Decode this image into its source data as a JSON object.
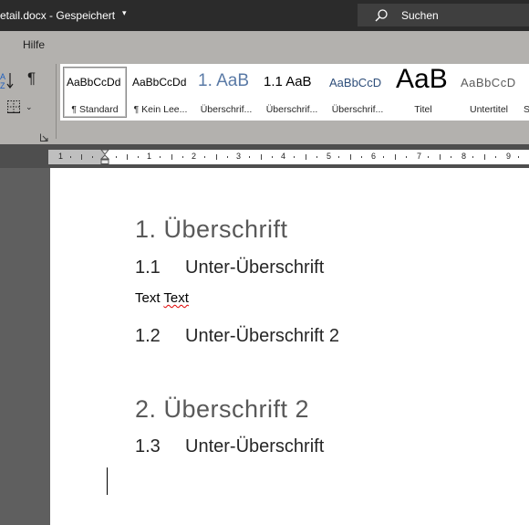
{
  "titlebar": {
    "filename": "etail.docx",
    "separator": "-",
    "status": "Gespeichert",
    "caret": "▾",
    "search_label": "Suchen"
  },
  "menu": {
    "help": "Hilfe"
  },
  "ribbon": {
    "pilcrow": "¶",
    "border_caret": "⌄",
    "styles": [
      {
        "preview": "AaBbCcDd",
        "name": "¶ Standard"
      },
      {
        "preview": "AaBbCcDd",
        "name": "¶ Kein Lee..."
      },
      {
        "preview": "1.  AaB",
        "name": "Überschrif..."
      },
      {
        "preview": "1.1  AaB",
        "name": "Überschrif..."
      },
      {
        "preview": "AaBbCcD",
        "name": "Überschrif..."
      },
      {
        "preview": "AaB",
        "name": "Titel"
      },
      {
        "preview": "AaBbCcD",
        "name": "Untertitel"
      },
      {
        "preview": "",
        "name": "S"
      }
    ]
  },
  "ruler": {
    "left_numbers": [
      "1"
    ],
    "numbers": [
      "1",
      "2",
      "3",
      "4",
      "5",
      "6",
      "7",
      "8",
      "9"
    ]
  },
  "document": {
    "h1_a": "1. Überschrift",
    "h2_a": {
      "num": "1.1",
      "text": "Unter-Überschrift"
    },
    "para_word1": "Text",
    "para_word2": "Text",
    "h2_b": {
      "num": "1.2",
      "text": "Unter-Überschrift 2"
    },
    "h1_b": "2. Überschrift 2",
    "h2_c": {
      "num": "1.3",
      "text": "Unter-Überschrift"
    }
  },
  "colors": {
    "titlebar_bg": "#2b2b2b",
    "ribbon_bg": "#b3b1ae",
    "heading1": "#595959",
    "heading2": "#262626",
    "spell_error": "#e00000"
  }
}
